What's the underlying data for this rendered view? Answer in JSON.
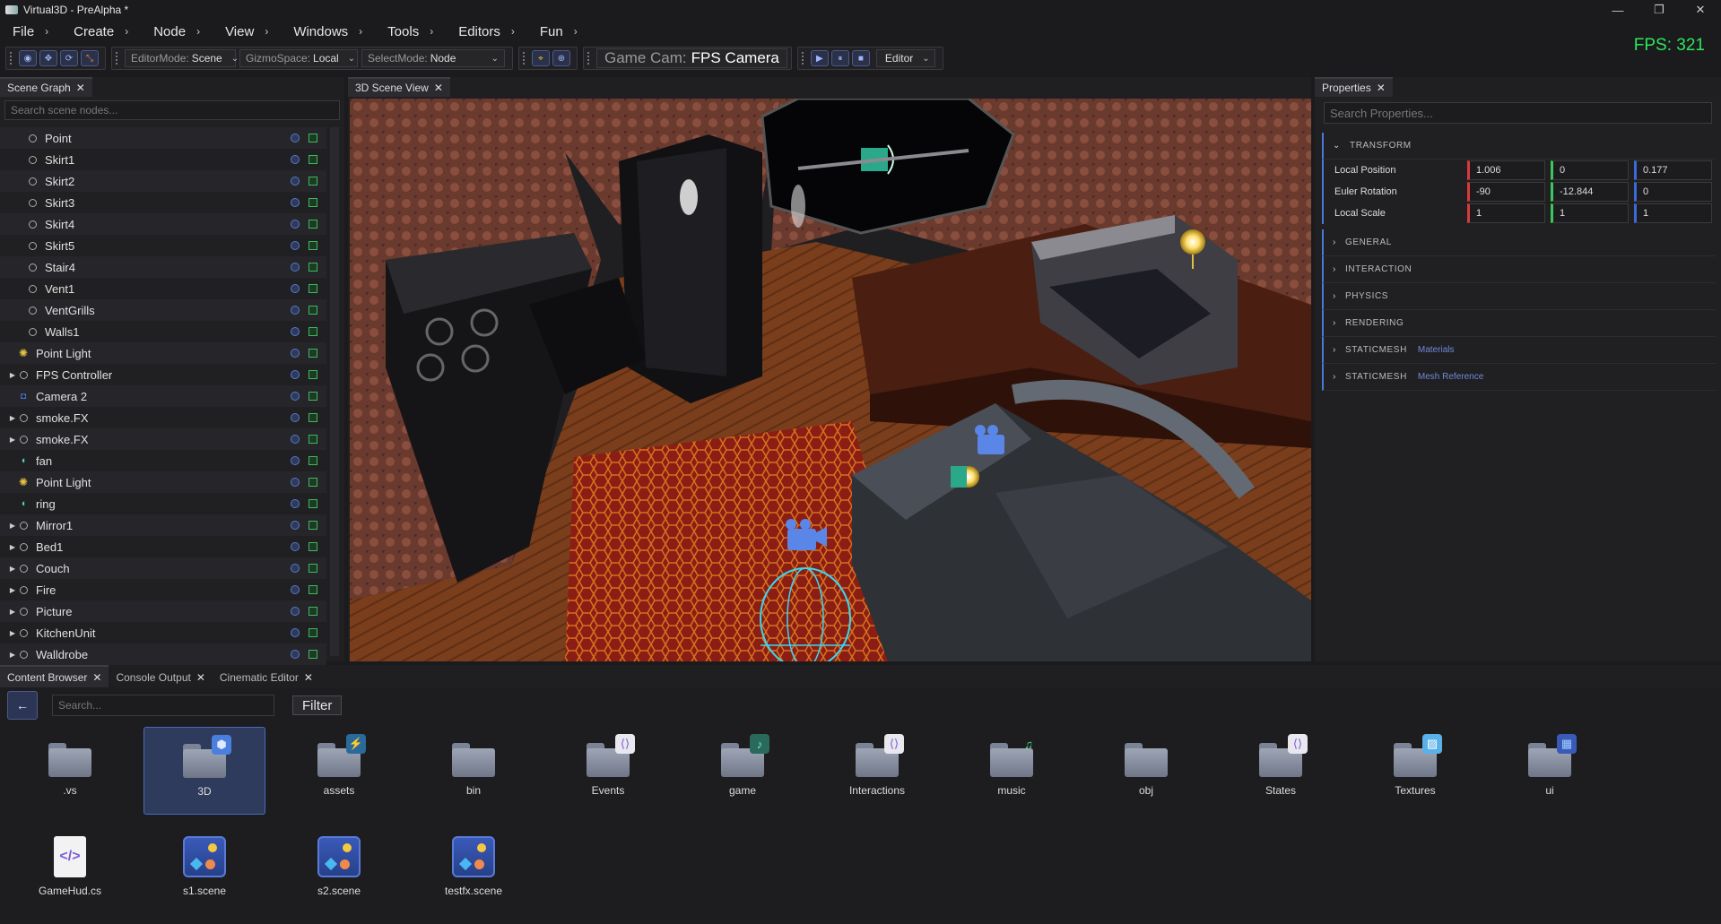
{
  "window": {
    "title": "Virtual3D - PreAlpha *",
    "controls": [
      "—",
      "❐",
      "✕"
    ]
  },
  "menu": [
    {
      "label": "File"
    },
    {
      "label": "Create"
    },
    {
      "label": "Node"
    },
    {
      "label": "View"
    },
    {
      "label": "Windows"
    },
    {
      "label": "Tools"
    },
    {
      "label": "Editors"
    },
    {
      "label": "Fun"
    }
  ],
  "fps": "FPS: 321",
  "toolbar": {
    "editor_mode": {
      "label": "EditorMode:",
      "value": "Scene"
    },
    "gizmo_space": {
      "label": "GizmoSpace:",
      "value": "Local"
    },
    "select_mode": {
      "label": "SelectMode:",
      "value": "Node"
    },
    "game_cam": {
      "label": "Game Cam:",
      "value": "FPS Camera"
    },
    "play_target": "Editor"
  },
  "scene_graph": {
    "tab": "Scene Graph",
    "search_placeholder": "Search scene nodes...",
    "nodes": [
      {
        "name": "Point",
        "type": "mesh",
        "expandable": false,
        "indent": 1
      },
      {
        "name": "Skirt1",
        "type": "mesh",
        "expandable": false,
        "indent": 1
      },
      {
        "name": "Skirt2",
        "type": "mesh",
        "expandable": false,
        "indent": 1
      },
      {
        "name": "Skirt3",
        "type": "mesh",
        "expandable": false,
        "indent": 1
      },
      {
        "name": "Skirt4",
        "type": "mesh",
        "expandable": false,
        "indent": 1
      },
      {
        "name": "Skirt5",
        "type": "mesh",
        "expandable": false,
        "indent": 1
      },
      {
        "name": "Stair4",
        "type": "mesh",
        "expandable": false,
        "indent": 1
      },
      {
        "name": "Vent1",
        "type": "mesh",
        "expandable": false,
        "indent": 1
      },
      {
        "name": "VentGrills",
        "type": "mesh",
        "expandable": false,
        "indent": 1
      },
      {
        "name": "Walls1",
        "type": "mesh",
        "expandable": false,
        "indent": 1
      },
      {
        "name": "Point Light",
        "type": "light",
        "expandable": false,
        "indent": 0
      },
      {
        "name": "FPS Controller",
        "type": "mesh",
        "expandable": true,
        "indent": 0
      },
      {
        "name": "Camera 2",
        "type": "cam",
        "expandable": false,
        "indent": 0
      },
      {
        "name": "smoke.FX",
        "type": "mesh",
        "expandable": true,
        "indent": 0
      },
      {
        "name": "smoke.FX",
        "type": "mesh",
        "expandable": true,
        "indent": 0
      },
      {
        "name": "fan",
        "type": "audio",
        "expandable": false,
        "indent": 0
      },
      {
        "name": "Point Light",
        "type": "light",
        "expandable": false,
        "indent": 0
      },
      {
        "name": "ring",
        "type": "audio",
        "expandable": false,
        "indent": 0
      },
      {
        "name": "Mirror1",
        "type": "mesh",
        "expandable": true,
        "indent": 0
      },
      {
        "name": "Bed1",
        "type": "mesh",
        "expandable": true,
        "indent": 0
      },
      {
        "name": "Couch",
        "type": "mesh",
        "expandable": true,
        "indent": 0
      },
      {
        "name": "Fire",
        "type": "mesh",
        "expandable": true,
        "indent": 0
      },
      {
        "name": "Picture",
        "type": "mesh",
        "expandable": true,
        "indent": 0
      },
      {
        "name": "KitchenUnit",
        "type": "mesh",
        "expandable": true,
        "indent": 0
      },
      {
        "name": "Walldrobe",
        "type": "mesh",
        "expandable": true,
        "indent": 0
      }
    ]
  },
  "viewport": {
    "tab": "3D Scene View"
  },
  "properties": {
    "tab": "Properties",
    "search_placeholder": "Search Properties...",
    "transform": {
      "header": "TRANSFORM",
      "rows": [
        {
          "label": "Local Position",
          "x": "1.006",
          "y": "0",
          "z": "0.177"
        },
        {
          "label": "Euler Rotation",
          "x": "-90",
          "y": "-12.844",
          "z": "0"
        },
        {
          "label": "Local Scale",
          "x": "1",
          "y": "1",
          "z": "1"
        }
      ]
    },
    "sections": [
      {
        "title": "GENERAL",
        "sub": ""
      },
      {
        "title": "INTERACTION",
        "sub": ""
      },
      {
        "title": "PHYSICS",
        "sub": ""
      },
      {
        "title": "RENDERING",
        "sub": ""
      },
      {
        "title": "STATICMESH",
        "sub": "Materials"
      },
      {
        "title": "STATICMESH",
        "sub": "Mesh Reference"
      }
    ]
  },
  "bottom_tabs": [
    {
      "label": "Content Browser",
      "active": true
    },
    {
      "label": "Console Output",
      "active": false
    },
    {
      "label": "Cinematic Editor",
      "active": false
    }
  ],
  "content_browser": {
    "search_placeholder": "Search...",
    "filter_label": "Filter",
    "items": [
      {
        "name": ".vs",
        "kind": "folder",
        "badge": ""
      },
      {
        "name": "3D",
        "kind": "folder",
        "badge": "cube",
        "selected": true
      },
      {
        "name": "assets",
        "kind": "folder",
        "badge": "assets"
      },
      {
        "name": "bin",
        "kind": "folder",
        "badge": ""
      },
      {
        "name": "Events",
        "kind": "folder",
        "badge": "code"
      },
      {
        "name": "game",
        "kind": "folder",
        "badge": "game"
      },
      {
        "name": "Interactions",
        "kind": "folder",
        "badge": "code"
      },
      {
        "name": "music",
        "kind": "folder",
        "badge": "music"
      },
      {
        "name": "obj",
        "kind": "folder",
        "badge": ""
      },
      {
        "name": "States",
        "kind": "folder",
        "badge": "code"
      },
      {
        "name": "Textures",
        "kind": "folder",
        "badge": "image"
      },
      {
        "name": "ui",
        "kind": "folder",
        "badge": "ui"
      },
      {
        "name": "GameHud.cs",
        "kind": "cs",
        "badge": ""
      },
      {
        "name": "s1.scene",
        "kind": "scene",
        "badge": ""
      },
      {
        "name": "s2.scene",
        "kind": "scene",
        "badge": ""
      },
      {
        "name": "testfx.scene",
        "kind": "scene",
        "badge": ""
      }
    ]
  }
}
